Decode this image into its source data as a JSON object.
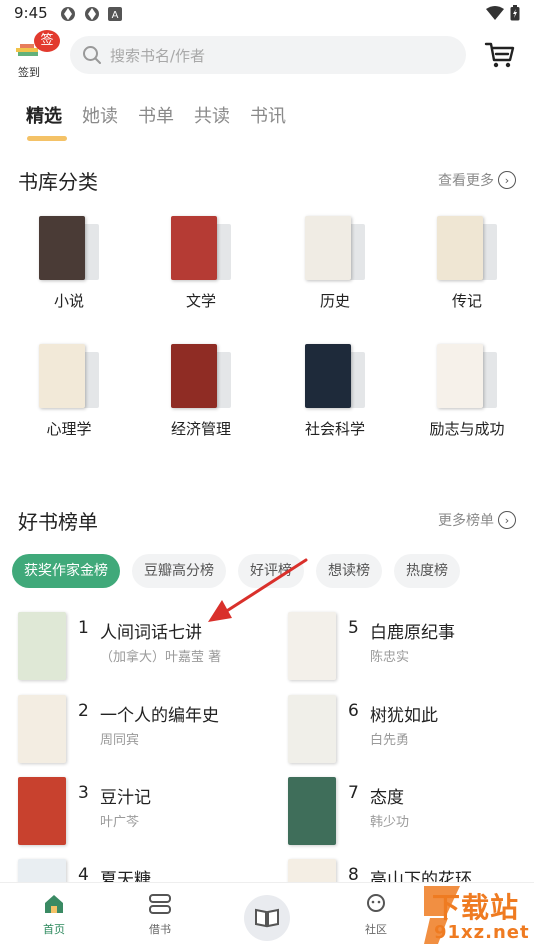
{
  "status_bar": {
    "time": "9:45",
    "a_icon": "A"
  },
  "header": {
    "signin_stamp": "签",
    "signin_label": "签到",
    "search_placeholder": "搜索书名/作者"
  },
  "tabs": [
    {
      "label": "精选"
    },
    {
      "label": "她读"
    },
    {
      "label": "书单"
    },
    {
      "label": "共读"
    },
    {
      "label": "书讯"
    }
  ],
  "library": {
    "title": "书库分类",
    "more_label": "查看更多",
    "categories": [
      {
        "label": "小说",
        "color": "#4a3b36"
      },
      {
        "label": "文学",
        "color": "#b53b34"
      },
      {
        "label": "历史",
        "color": "#f0ece4"
      },
      {
        "label": "传记",
        "color": "#efe6d3"
      },
      {
        "label": "心理学",
        "color": "#f2e9d8"
      },
      {
        "label": "经济管理",
        "color": "#8f2c24"
      },
      {
        "label": "社会科学",
        "color": "#1e2a3a"
      },
      {
        "label": "励志与成功",
        "color": "#f6f1ea"
      }
    ]
  },
  "rankings": {
    "title": "好书榜单",
    "more_label": "更多榜单",
    "chips": [
      {
        "label": "获奖作家金榜"
      },
      {
        "label": "豆瓣高分榜"
      },
      {
        "label": "好评榜"
      },
      {
        "label": "想读榜"
      },
      {
        "label": "热度榜"
      }
    ],
    "books": [
      {
        "rank": "1",
        "title": "人间词话七讲",
        "author": "（加拿大）叶嘉莹 著",
        "color": "#dfe8d6"
      },
      {
        "rank": "2",
        "title": "一个人的编年史",
        "author": "周同宾",
        "color": "#f3ede2"
      },
      {
        "rank": "3",
        "title": "豆汁记",
        "author": "叶广芩",
        "color": "#c8412e"
      },
      {
        "rank": "4",
        "title": "夏天糖",
        "author": "",
        "color": "#e9eef2"
      },
      {
        "rank": "5",
        "title": "白鹿原纪事",
        "author": "陈忠实",
        "color": "#f3f0ea"
      },
      {
        "rank": "6",
        "title": "树犹如此",
        "author": "白先勇",
        "color": "#f0efe9"
      },
      {
        "rank": "7",
        "title": "态度",
        "author": "韩少功",
        "color": "#3f6e5a"
      },
      {
        "rank": "8",
        "title": "高山下的花环",
        "author": "",
        "color": "#f4eee4"
      }
    ]
  },
  "bottom_nav": {
    "home": "首页",
    "borrow": "借书",
    "community": "社区"
  },
  "watermark": {
    "line1": "下载站",
    "line2": "91xz.net"
  },
  "colors": {
    "accent": "#40a97a",
    "tab_indicator": "#f4c267",
    "stamp": "#e23a2e"
  }
}
